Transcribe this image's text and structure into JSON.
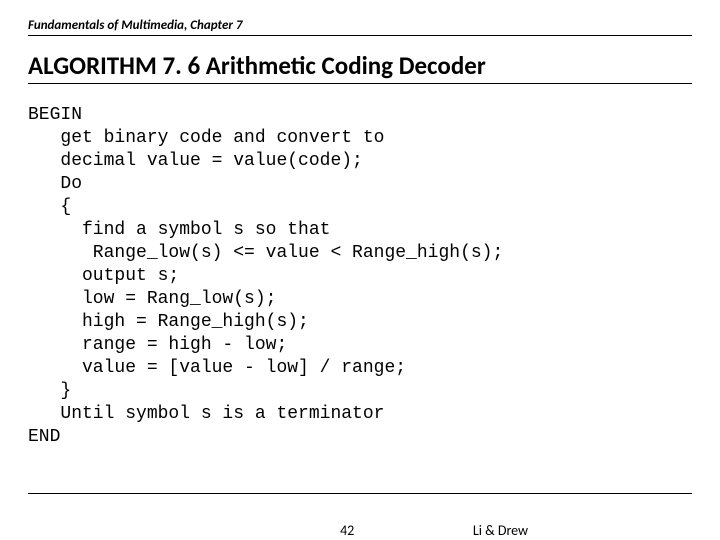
{
  "header": "Fundamentals of Multimedia, Chapter 7",
  "title": "ALGORITHM 7. 6 Arithmetic Coding Decoder",
  "code": "BEGIN\n   get binary code and convert to\n   decimal value = value(code);\n   Do\n   {\n     find a symbol s so that\n      Range_low(s) <= value < Range_high(s);\n     output s;\n     low = Rang_low(s);\n     high = Range_high(s);\n     range = high - low;\n     value = [value - low] / range;\n   }\n   Until symbol s is a terminator\nEND",
  "footer": {
    "page": "42",
    "authors": "Li & Drew"
  }
}
